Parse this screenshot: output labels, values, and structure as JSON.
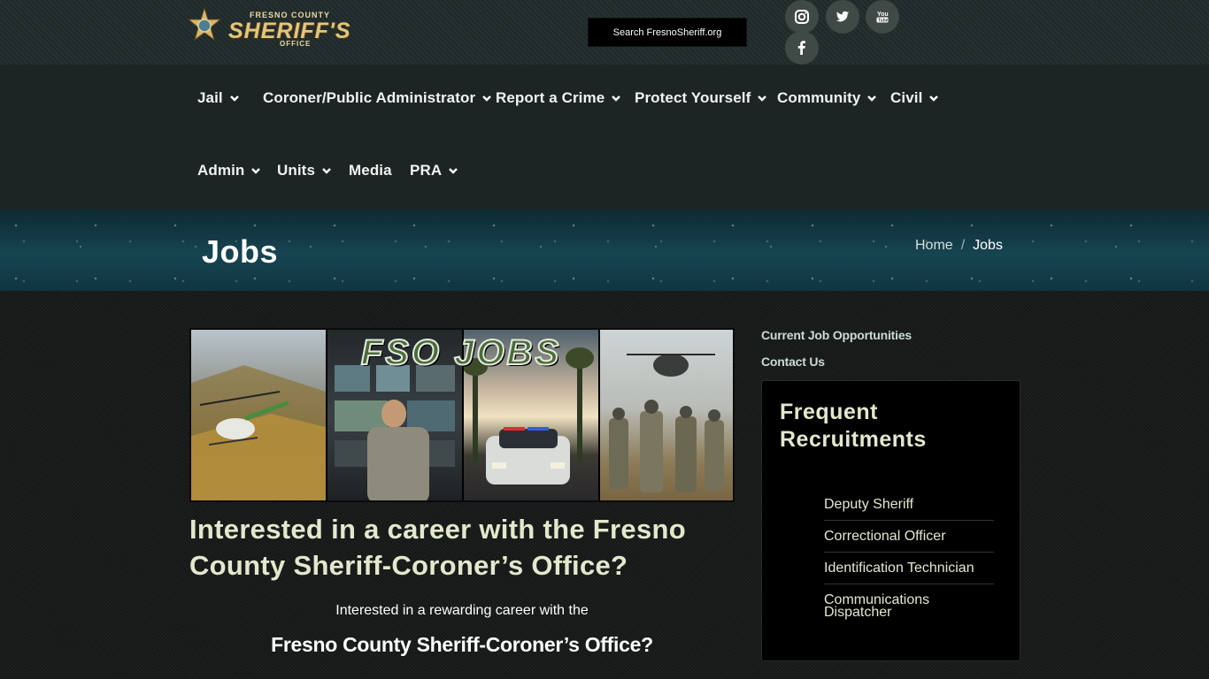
{
  "header": {
    "logo": {
      "top_line": "FRESNO COUNTY",
      "main_line": "SHERIFF'S",
      "sub_line": "OFFICE"
    },
    "search_label": "Search FresnoSheriff.org",
    "social": [
      {
        "name": "instagram",
        "icon": "instagram-icon"
      },
      {
        "name": "twitter",
        "icon": "twitter-icon"
      },
      {
        "name": "youtube",
        "icon": "youtube-icon"
      },
      {
        "name": "facebook",
        "icon": "facebook-icon"
      }
    ]
  },
  "nav": {
    "items": [
      {
        "label": "Jail",
        "dropdown": true
      },
      {
        "label": "Coroner/Public Administrator",
        "dropdown": true
      },
      {
        "label": "Report a Crime",
        "dropdown": true
      },
      {
        "label": "Protect Yourself",
        "dropdown": true
      },
      {
        "label": "Community",
        "dropdown": true
      },
      {
        "label": "Civil",
        "dropdown": true
      },
      {
        "label": "Admin",
        "dropdown": true
      },
      {
        "label": "Units",
        "dropdown": true
      },
      {
        "label": "Media",
        "dropdown": false
      },
      {
        "label": "PRA",
        "dropdown": true
      }
    ]
  },
  "page_header": {
    "title": "Jobs",
    "breadcrumb": {
      "home": "Home",
      "separator": "/",
      "current": "Jobs"
    }
  },
  "main": {
    "banner_title": "FSO JOBS",
    "headline": "Interested in a career with the Fresno County Sheriff-Coroner’s Office?",
    "lead_sub": "Interested in a rewarding career with the",
    "lead_strong": "Fresno County Sheriff-Coroner’s Office?"
  },
  "sidebar": {
    "links": [
      "Current Job Opportunities",
      "Contact Us"
    ],
    "recruit_title": "Frequent Recruitments",
    "recruitments": [
      "Deputy Sheriff",
      "Correctional Officer",
      "Identification Technician",
      "Communications Dispatcher"
    ]
  },
  "colors": {
    "topbar": "#263030",
    "nav_bg": "#1c2523",
    "header_bg": "#164451",
    "accent_text": "#e3e8cc",
    "logo_gold": "#e3c57c"
  }
}
